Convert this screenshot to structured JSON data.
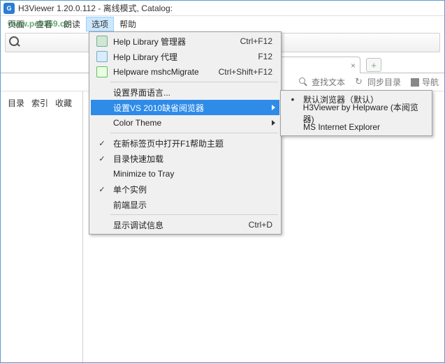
{
  "title": "H3Viewer 1.20.0.112 - 离线模式, Catalog:",
  "menubar": [
    "页面",
    "查看",
    "朗读",
    "选项",
    "帮助"
  ],
  "watermark": "www.pc0359.cn",
  "tab": {
    "close": "×"
  },
  "newtab_glyph": "+",
  "subtoolbar": {
    "find": "查找文本",
    "sync": "同步目录",
    "nav": "导航"
  },
  "sidebar_tabs": [
    "目录",
    "索引",
    "收藏"
  ],
  "dropdown": {
    "items": [
      {
        "label": "Help Library 管理器",
        "accel": "Ctrl+F12",
        "icon": "b1"
      },
      {
        "label": "Help Library 代理",
        "accel": "F12",
        "icon": "b2"
      },
      {
        "label": "Helpware mshcMigrate",
        "accel": "Ctrl+Shift+F12",
        "icon": "b3"
      }
    ],
    "lang": "设置界面语言...",
    "browser": "设置VS 2010缺省阅览器",
    "theme": "Color Theme",
    "f1": "在新标签页中打开F1帮助主题",
    "fastload": "目录快速加载",
    "tray": "Minimize to Tray",
    "single": "单个实例",
    "front": "前端显示",
    "debug": "显示调试信息",
    "debug_accel": "Ctrl+D"
  },
  "submenu": {
    "items": [
      {
        "label": "默认浏览器（默认）",
        "selected": true
      },
      {
        "label": "H3Viewer by Helpware (本阅览器)",
        "selected": false
      },
      {
        "label": "MS Internet Explorer",
        "selected": false
      }
    ]
  }
}
